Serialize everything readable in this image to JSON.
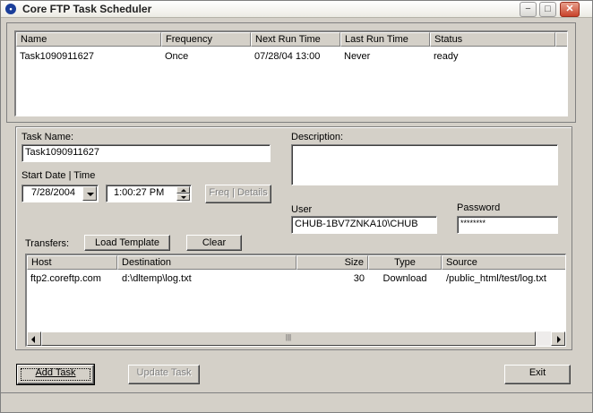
{
  "window": {
    "title": "Core FTP Task Scheduler",
    "icon": "core-ftp-icon",
    "controls": {
      "minimize": "−",
      "maximize": "□",
      "close": "✕"
    }
  },
  "tasks": {
    "columns": [
      "Name",
      "Frequency",
      "Next Run Time",
      "Last Run Time",
      "Status"
    ],
    "rows": [
      {
        "name": "Task1090911627",
        "frequency": "Once",
        "next_run": "07/28/04  13:00",
        "last_run": "Never",
        "status": "ready"
      }
    ]
  },
  "form": {
    "task_name_label": "Task Name:",
    "task_name_value": "Task1090911627",
    "description_label": "Description:",
    "description_value": "",
    "start_label": "Start Date | Time",
    "start_date": "7/28/2004",
    "start_time": "1:00:27 PM",
    "freq_button": "Freq | Details",
    "user_label": "User",
    "user_value": "CHUB-1BV7ZNKA10\\CHUB",
    "password_label": "Password",
    "password_value": "********"
  },
  "transfers": {
    "label": "Transfers:",
    "load_template": "Load Template",
    "clear": "Clear",
    "columns": [
      "Host",
      "Destination",
      "Size",
      "Type",
      "Source"
    ],
    "rows": [
      {
        "host": "ftp2.coreftp.com",
        "destination": "d:\\dltemp\\log.txt",
        "size": "30",
        "type": "Download",
        "source": "/public_html/test/log.txt"
      }
    ],
    "scroll_thumb": "|||"
  },
  "buttons": {
    "add_task": "Add Task",
    "update_task": "Update Task",
    "exit": "Exit"
  }
}
